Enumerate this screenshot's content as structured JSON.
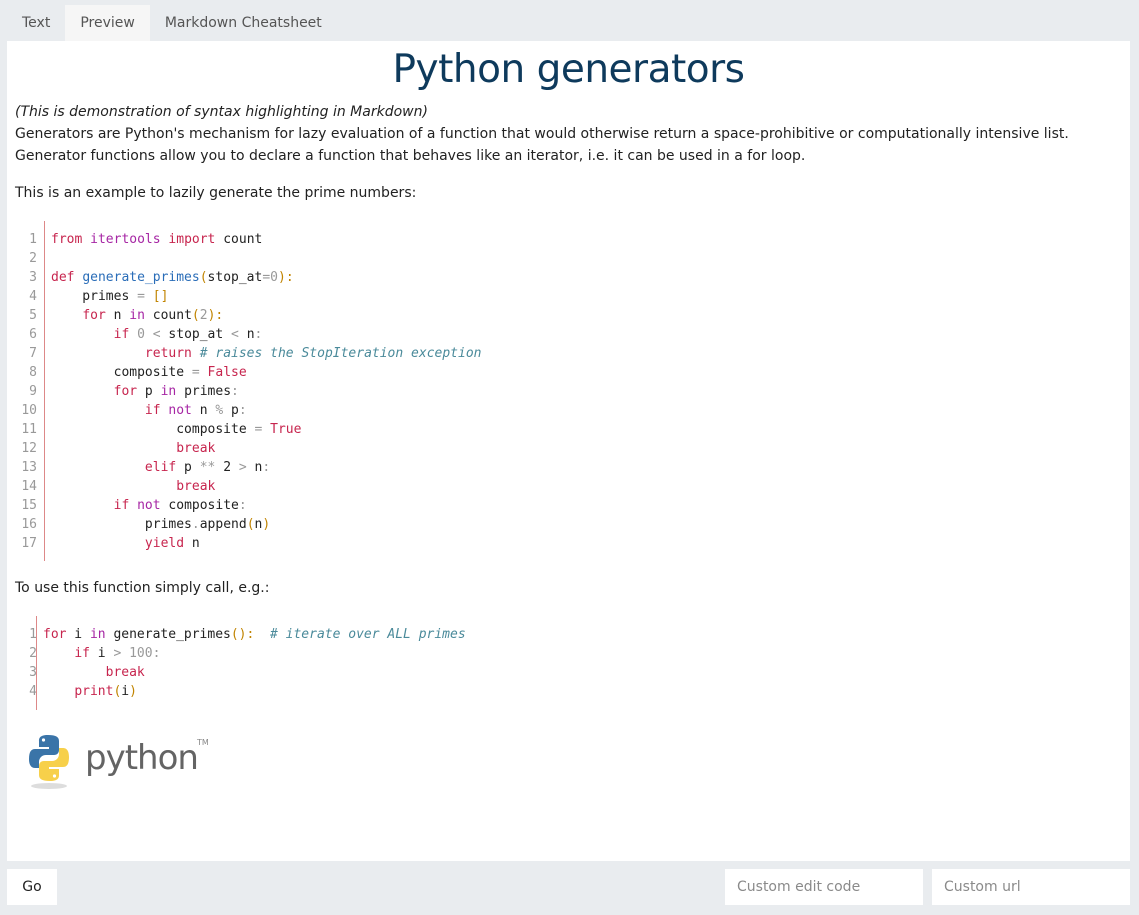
{
  "tabs": [
    {
      "label": "Text"
    },
    {
      "label": "Preview",
      "active": true
    },
    {
      "label": "Markdown Cheatsheet"
    }
  ],
  "content": {
    "title": "Python generators",
    "intro": "(This is demonstration of syntax highlighting in Markdown)",
    "para1": "Generators are Python's mechanism for lazy evaluation of a function that would otherwise return a space-prohibitive or computationally intensive list. Generator functions allow you to declare a function that behaves like an iterator, i.e. it can be used in a for loop.",
    "para2": "This is an example to lazily generate the prime numbers:",
    "para3": "To use this function simply call, e.g.:",
    "logo_text": "python",
    "logo_tm": "TM"
  },
  "code1": [
    [
      [
        "kw",
        "from"
      ],
      [
        "t",
        " "
      ],
      [
        "kw2",
        "itertools"
      ],
      [
        "t",
        " "
      ],
      [
        "kw",
        "import"
      ],
      [
        "t",
        " count"
      ]
    ],
    [],
    [
      [
        "kw",
        "def"
      ],
      [
        "t",
        " "
      ],
      [
        "fn",
        "generate_primes"
      ],
      [
        "pn",
        "("
      ],
      [
        "t",
        "stop_at"
      ],
      [
        "num",
        "="
      ],
      [
        "num",
        "0"
      ],
      [
        "pn",
        "):"
      ]
    ],
    [
      [
        "t",
        "    primes "
      ],
      [
        "num",
        "="
      ],
      [
        "t",
        " "
      ],
      [
        "pn",
        "[]"
      ]
    ],
    [
      [
        "t",
        "    "
      ],
      [
        "kw",
        "for"
      ],
      [
        "t",
        " n "
      ],
      [
        "kw2",
        "in"
      ],
      [
        "t",
        " count"
      ],
      [
        "pn",
        "("
      ],
      [
        "num",
        "2"
      ],
      [
        "pn",
        "):"
      ]
    ],
    [
      [
        "t",
        "        "
      ],
      [
        "kw",
        "if"
      ],
      [
        "t",
        " "
      ],
      [
        "num",
        "0"
      ],
      [
        "t",
        " "
      ],
      [
        "num",
        "<"
      ],
      [
        "t",
        " stop_at "
      ],
      [
        "num",
        "<"
      ],
      [
        "t",
        " n"
      ],
      [
        "num",
        ":"
      ]
    ],
    [
      [
        "t",
        "            "
      ],
      [
        "kw",
        "return"
      ],
      [
        "t",
        " "
      ],
      [
        "cm",
        "# raises the StopIteration exception"
      ]
    ],
    [
      [
        "t",
        "        composite "
      ],
      [
        "num",
        "="
      ],
      [
        "t",
        " "
      ],
      [
        "kw",
        "False"
      ]
    ],
    [
      [
        "t",
        "        "
      ],
      [
        "kw",
        "for"
      ],
      [
        "t",
        " p "
      ],
      [
        "kw2",
        "in"
      ],
      [
        "t",
        " primes"
      ],
      [
        "num",
        ":"
      ]
    ],
    [
      [
        "t",
        "            "
      ],
      [
        "kw",
        "if"
      ],
      [
        "t",
        " "
      ],
      [
        "kw2",
        "not"
      ],
      [
        "t",
        " n "
      ],
      [
        "num",
        "%"
      ],
      [
        "t",
        " p"
      ],
      [
        "num",
        ":"
      ]
    ],
    [
      [
        "t",
        "                composite "
      ],
      [
        "num",
        "="
      ],
      [
        "t",
        " "
      ],
      [
        "kw",
        "True"
      ]
    ],
    [
      [
        "t",
        "                "
      ],
      [
        "kw",
        "break"
      ]
    ],
    [
      [
        "t",
        "            "
      ],
      [
        "kw",
        "elif"
      ],
      [
        "t",
        " p "
      ],
      [
        "num",
        "**"
      ],
      [
        "t",
        " 2 "
      ],
      [
        "num",
        ">"
      ],
      [
        "t",
        " n"
      ],
      [
        "num",
        ":"
      ]
    ],
    [
      [
        "t",
        "                "
      ],
      [
        "kw",
        "break"
      ]
    ],
    [
      [
        "t",
        "        "
      ],
      [
        "kw",
        "if"
      ],
      [
        "t",
        " "
      ],
      [
        "kw2",
        "not"
      ],
      [
        "t",
        " composite"
      ],
      [
        "num",
        ":"
      ]
    ],
    [
      [
        "t",
        "            primes"
      ],
      [
        "num",
        "."
      ],
      [
        "t",
        "append"
      ],
      [
        "pn",
        "("
      ],
      [
        "t",
        "n"
      ],
      [
        "pn",
        ")"
      ]
    ],
    [
      [
        "t",
        "            "
      ],
      [
        "kw",
        "yield"
      ],
      [
        "t",
        " n"
      ]
    ]
  ],
  "code2": [
    [
      [
        "kw",
        "for"
      ],
      [
        "t",
        " i "
      ],
      [
        "kw2",
        "in"
      ],
      [
        "t",
        " generate_primes"
      ],
      [
        "pn",
        "():"
      ],
      [
        "t",
        "  "
      ],
      [
        "cm",
        "# iterate over ALL primes"
      ]
    ],
    [
      [
        "t",
        "    "
      ],
      [
        "kw",
        "if"
      ],
      [
        "t",
        " i "
      ],
      [
        "num",
        ">"
      ],
      [
        "t",
        " "
      ],
      [
        "num",
        "100"
      ],
      [
        "num",
        ":"
      ]
    ],
    [
      [
        "t",
        "        "
      ],
      [
        "kw",
        "break"
      ]
    ],
    [
      [
        "t",
        "    "
      ],
      [
        "kw",
        "print"
      ],
      [
        "pn",
        "("
      ],
      [
        "t",
        "i"
      ],
      [
        "pn",
        ")"
      ]
    ]
  ],
  "bottom": {
    "go_label": "Go",
    "edit_code_placeholder": "Custom edit code",
    "url_placeholder": "Custom url"
  }
}
